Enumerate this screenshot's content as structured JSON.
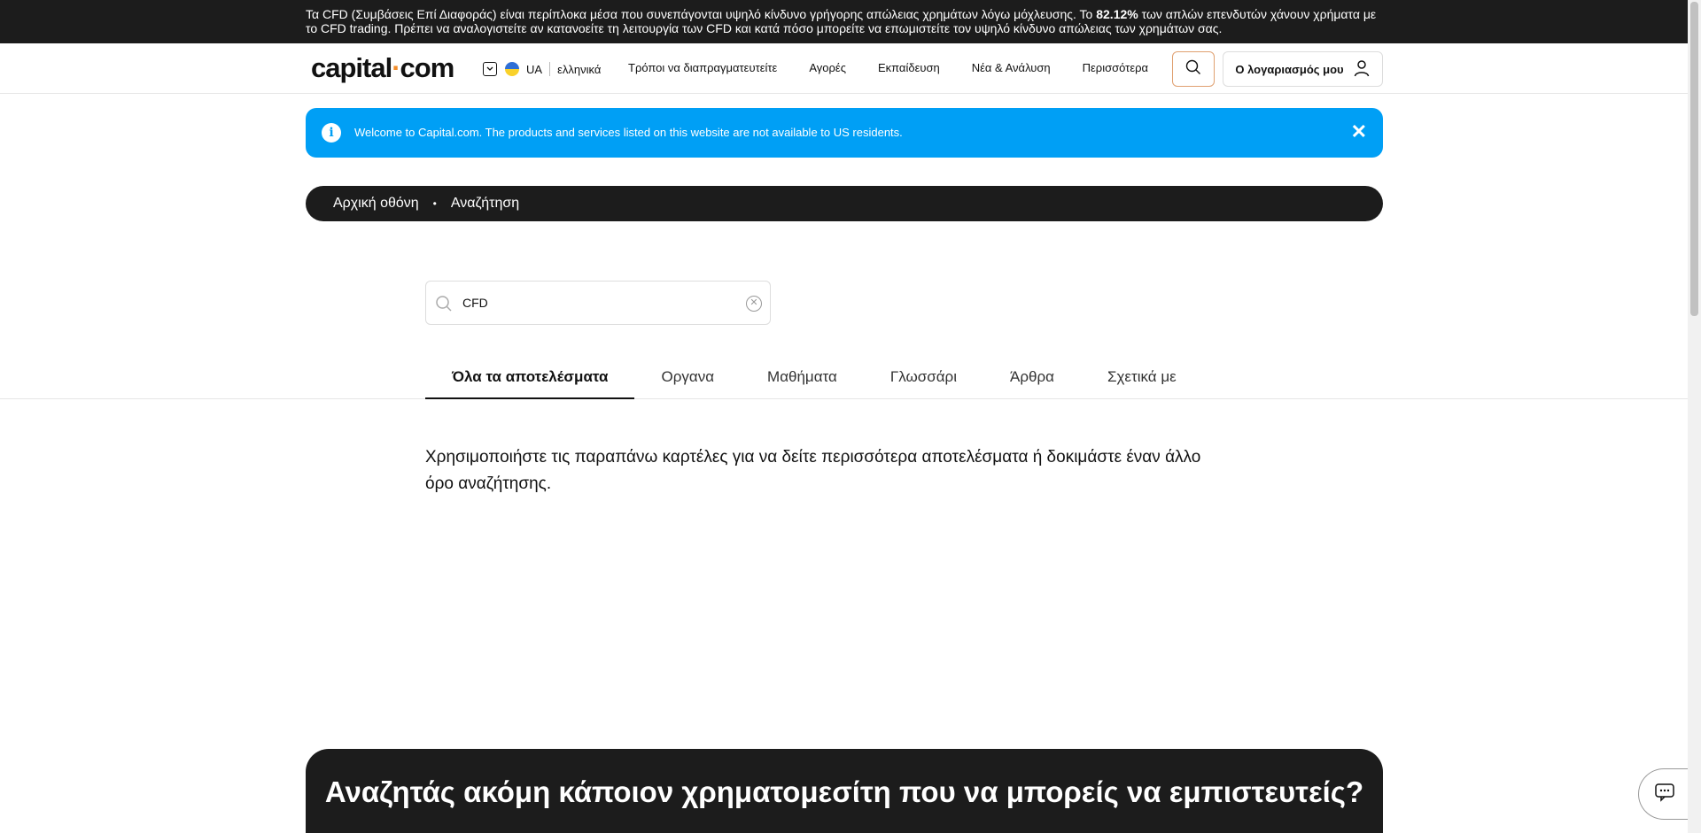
{
  "risk_banner": {
    "text_before": "Τα CFD (Συμβάσεις Επί Διαφοράς) είναι περίπλοκα μέσα που συνεπάγονται υψηλό κίνδυνο γρήγορης απώλειας χρημάτων λόγω μόχλευσης. Το ",
    "percent": "82.12%",
    "text_after": " των απλών επενδυτών χάνουν χρήματα με το CFD trading. Πρέπει να αναλογιστείτε αν κατανοείτε τη λειτουργία των CFD και κατά πόσο μπορείτε να επωμιστείτε τον υψηλό κίνδυνο απώλειας των χρημάτων σας."
  },
  "header": {
    "logo_main": "capital",
    "logo_dot": "·",
    "logo_end": "com",
    "region_code": "UA",
    "language": "ελληνικά",
    "nav": [
      {
        "label": "Τρόποι να διαπραγματευτείτε"
      },
      {
        "label": "Αγορές"
      },
      {
        "label": "Εκπαίδευση"
      },
      {
        "label": "Νέα & Ανάλυση"
      },
      {
        "label": "Περισσότερα"
      }
    ],
    "account_label": "Ο λογαριασμός μου"
  },
  "welcome": {
    "message": "Welcome to Capital.com. The products and services listed on this website are not available to US residents.",
    "info_glyph": "i",
    "close_glyph": "✕"
  },
  "breadcrumb": {
    "home": "Αρχική οθόνη",
    "separator": "•",
    "current": "Αναζήτηση"
  },
  "search": {
    "value": "CFD",
    "clear_glyph": "✕"
  },
  "tabs": [
    {
      "label": "Όλα τα αποτελέσματα",
      "active": true
    },
    {
      "label": "Οργανα",
      "active": false
    },
    {
      "label": "Μαθήματα",
      "active": false
    },
    {
      "label": "Γλωσσάρι",
      "active": false
    },
    {
      "label": "Άρθρα",
      "active": false
    },
    {
      "label": "Σχετικά με",
      "active": false
    }
  ],
  "results_hint": "Χρησιμοποιήστε τις παραπάνω καρτέλες για να δείτε περισσότερα αποτελέσματα ή δοκιμάστε έναν άλλο όρο αναζήτησης.",
  "promo": {
    "title": "Αναζητάς ακόμη κάποιον χρηματομεσίτη που να μπορείς να εμπιστευτείς?"
  },
  "colors": {
    "dark": "#1c1c1c",
    "alert_blue": "#009ff5",
    "accent_orange": "#f28c28"
  },
  "icons": {
    "search": "search-icon",
    "user": "user-icon",
    "chat": "chat-icon",
    "info": "info-icon",
    "close": "close-icon",
    "chevron": "chevron-down-icon",
    "flag": "flag-ua-icon"
  }
}
